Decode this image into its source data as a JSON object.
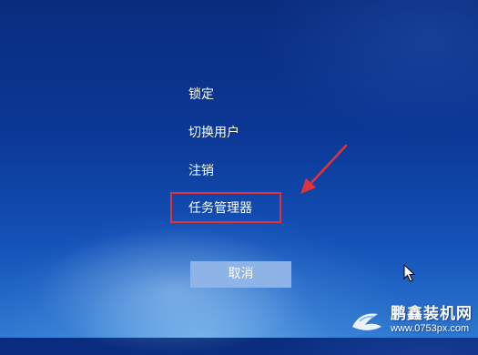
{
  "menu": {
    "lock": "锁定",
    "switch_user": "切换用户",
    "sign_out": "注销",
    "task_manager": "任务管理器"
  },
  "cancel_button": "取消",
  "watermark": {
    "brand": "鹏鑫装机网",
    "url": "www.0753px.com"
  },
  "colors": {
    "highlight": "#e2333b",
    "button": "#8eb3e6",
    "text": "#ffffff"
  }
}
